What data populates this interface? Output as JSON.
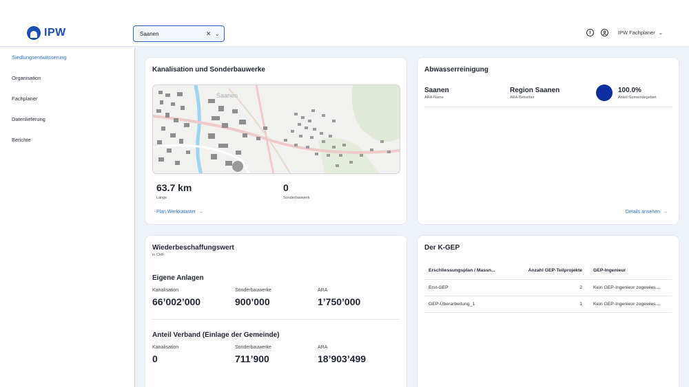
{
  "app": {
    "logo_text": "IPW"
  },
  "search": {
    "value": "Saanen"
  },
  "header": {
    "user_name": "IPW Fachplaner"
  },
  "sidebar": {
    "items": [
      {
        "label": "Siedlungsentwässerung"
      },
      {
        "label": "Organisation"
      },
      {
        "label": "Fachplaner"
      },
      {
        "label": "Datenlieferung"
      },
      {
        "label": "Berichte"
      }
    ]
  },
  "kanalisation": {
    "title": "Kanalisation und Sonderbauwerke",
    "map_label": "Saanen",
    "length_value": "63.7 km",
    "length_caption": "Länge",
    "sonder_value": "0",
    "sonder_caption": "Sonderbauwerk",
    "link_label": "Plan Werkkataster"
  },
  "abwasser": {
    "title": "Abwasserreinigung",
    "ara_name": "Saanen",
    "ara_name_caption": "ARA-Name",
    "ara_operator": "Region Saanen",
    "ara_operator_caption": "ARA-Betreiber",
    "share_value": "100.0%",
    "share_caption": "Anteil Gemeindegebiet",
    "link_label": "Details ansehen",
    "colors": {
      "share_dot": "#0b2f9c"
    }
  },
  "wiederbeschaffung": {
    "title": "Wiederbeschaffungswert",
    "subtitle": "in CHF",
    "eigene": {
      "title": "Eigene Anlagen",
      "items": [
        {
          "caption": "Kanalisation",
          "value": "66’002’000"
        },
        {
          "caption": "Sonderbauwerke",
          "value": "900’000"
        },
        {
          "caption": "ARA",
          "value": "1’750’000"
        }
      ]
    },
    "verband": {
      "title": "Anteil Verband (Einlage der Gemeinde)",
      "items": [
        {
          "caption": "Kanalisation",
          "value": "0"
        },
        {
          "caption": "Sonderbauwerke",
          "value": "711’900"
        },
        {
          "caption": "ARA",
          "value": "18’903’499"
        }
      ]
    }
  },
  "kgep": {
    "title": "Der K-GEP",
    "columns": [
      "Erschliessungsplan / Massn...",
      "Anzahl GEP-Teilprojekte",
      "GEP-Ingenieur"
    ],
    "rows": [
      {
        "plan": "Erst-GEP",
        "count": "2",
        "engineer": "Kein GEP-Ingenieur zugewies..."
      },
      {
        "plan": "GEP-Überarbeitung_1",
        "count": "1",
        "engineer": "Kein GEP-Ingenieur zugewies..."
      }
    ]
  }
}
